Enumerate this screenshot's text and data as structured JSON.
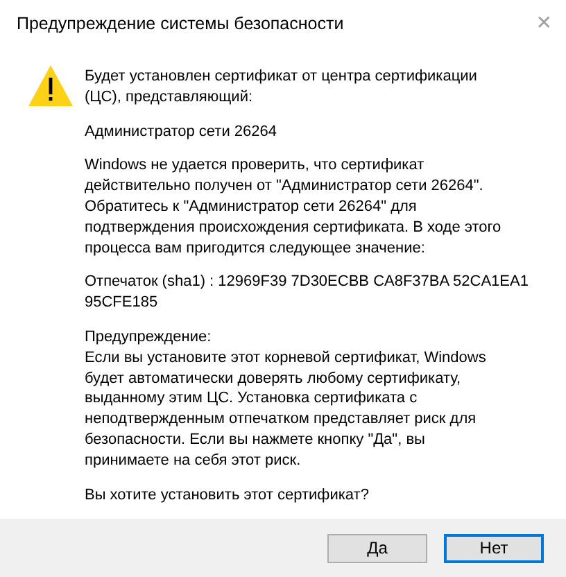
{
  "window": {
    "title": "Предупреждение системы безопасности",
    "close": "✕"
  },
  "message": {
    "paragraphs": [
      {
        "lines": [
          "Будет установлен сертификат от центра сертификации",
          "(ЦС), представляющий:"
        ]
      },
      {
        "lines": [
          "Администратор сети 26264"
        ]
      },
      {
        "lines": [
          "Windows не удается проверить, что сертификат",
          "действительно получен от \"Администратор сети 26264\".",
          "Обратитесь к \"Администратор сети 26264\" для",
          "подтверждения происхождения сертификата. В ходе этого",
          "процесса вам пригодится следующее значение:"
        ]
      },
      {
        "lines": [
          "Отпечаток (sha1) : 12969F39 7D30ECBB CA8F37BA 52CA1EA1",
          "95CFE185"
        ]
      },
      {
        "lines": [
          "Предупреждение:",
          "Если вы установите этот корневой сертификат, Windows",
          "будет автоматически доверять любому сертификату,",
          "выданному этим ЦС. Установка сертификата с",
          "неподтвержденным отпечатком представляет риск для",
          "безопасности. Если вы нажмете кнопку \"Да\", вы",
          "принимаете на себя этот риск."
        ]
      },
      {
        "lines": [
          "Вы хотите установить этот сертификат?"
        ]
      }
    ]
  },
  "buttons": [
    {
      "label": "Да",
      "default": false
    },
    {
      "label": "Нет",
      "default": true
    }
  ]
}
